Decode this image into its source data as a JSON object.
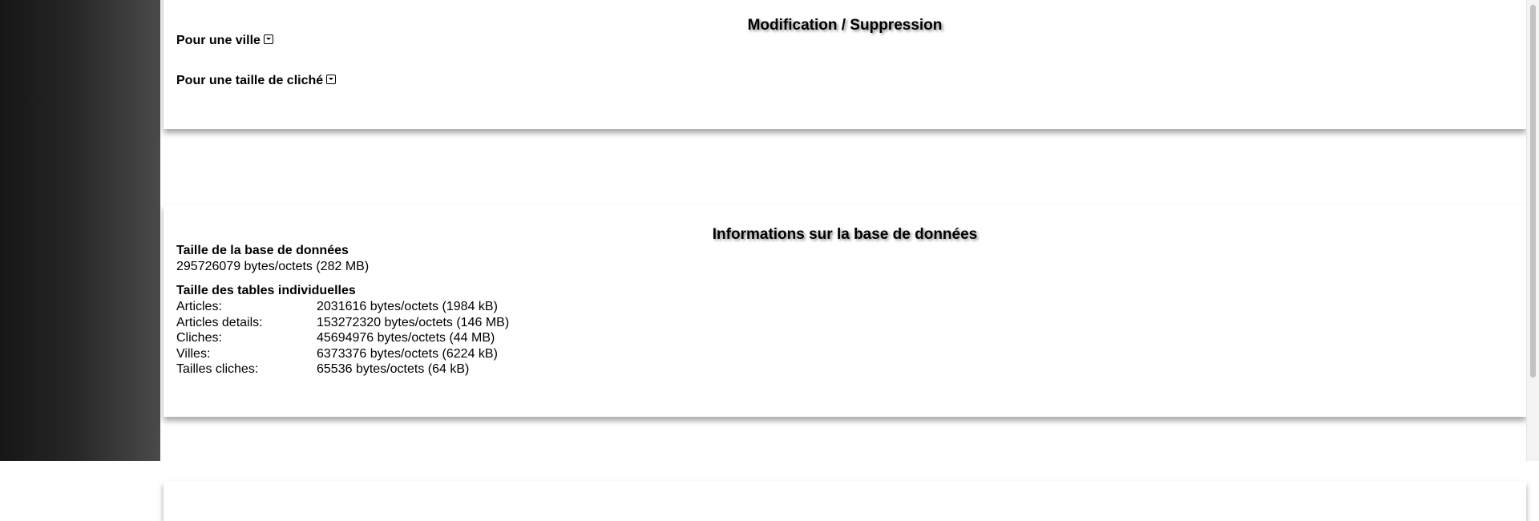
{
  "modification_section": {
    "title": "Modification / Suppression",
    "filters": [
      {
        "label": "Pour une ville"
      },
      {
        "label": "Pour une taille de cliché"
      }
    ]
  },
  "info_section": {
    "title": "Informations sur la base de données",
    "db_size_heading": "Taille de la base de données",
    "db_size_value": "295726079 bytes/octets (282 MB)",
    "tables_heading": "Taille des tables individuelles",
    "tables": [
      {
        "name": "Articles:",
        "size": "2031616 bytes/octets (1984 kB)"
      },
      {
        "name": "Articles details:",
        "size": "153272320 bytes/octets (146 MB)"
      },
      {
        "name": "Cliches:",
        "size": "45694976 bytes/octets (44 MB)"
      },
      {
        "name": "Villes:",
        "size": "6373376 bytes/octets (6224 kB)"
      },
      {
        "name": "Tailles cliches:",
        "size": "65536 bytes/octets (64 kB)"
      }
    ]
  },
  "icons": {
    "dropdown": "chevron-down-box-icon"
  }
}
